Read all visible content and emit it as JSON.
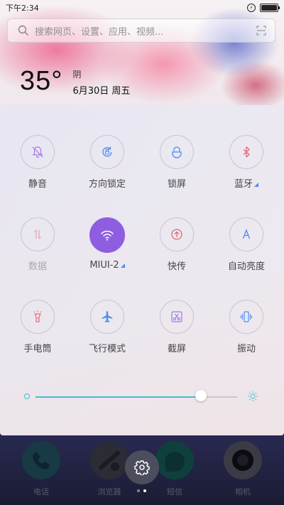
{
  "status_bar": {
    "time": "下午2:34",
    "battery_percent": 100
  },
  "search": {
    "placeholder": "搜索网页、设置、应用、视频..."
  },
  "weather": {
    "temperature": "35°",
    "condition": "阴",
    "date": "6月30日 周五"
  },
  "toggles": [
    {
      "label": "静音",
      "icon": "bell-mute-icon",
      "active": false
    },
    {
      "label": "方向锁定",
      "icon": "rotation-lock-icon",
      "active": false
    },
    {
      "label": "锁屏",
      "icon": "lock-icon",
      "active": false
    },
    {
      "label": "蓝牙",
      "icon": "bluetooth-icon",
      "active": false,
      "has_more": true
    },
    {
      "label": "数据",
      "icon": "mobile-data-icon",
      "active": false,
      "disabled": true
    },
    {
      "label": "MIUI-2",
      "icon": "wifi-icon",
      "active": true,
      "has_more": true
    },
    {
      "label": "快传",
      "icon": "quick-share-icon",
      "active": false
    },
    {
      "label": "自动亮度",
      "icon": "auto-brightness-icon",
      "active": false
    },
    {
      "label": "手电筒",
      "icon": "flashlight-icon",
      "active": false
    },
    {
      "label": "飞行模式",
      "icon": "airplane-icon",
      "active": false
    },
    {
      "label": "截屏",
      "icon": "screenshot-icon",
      "active": false
    },
    {
      "label": "振动",
      "icon": "vibrate-icon",
      "active": false
    }
  ],
  "brightness": {
    "level": 0.82
  },
  "dock": [
    {
      "label": "电话",
      "icon": "phone-icon"
    },
    {
      "label": "浏览器",
      "icon": "browser-icon"
    },
    {
      "label": "短信",
      "icon": "messages-icon"
    },
    {
      "label": "相机",
      "icon": "camera-icon"
    }
  ],
  "colors": {
    "accent": "#8f5ee0",
    "slider": "#49b9cf",
    "icon_blue": "#4b8bf1",
    "icon_red": "#e26b73",
    "icon_purple": "#a178e6"
  }
}
